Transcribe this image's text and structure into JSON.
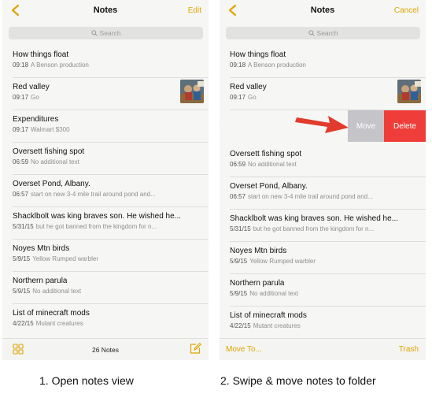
{
  "colors": {
    "accent": "#e0a500",
    "delete": "#ef3e3a",
    "move": "#c5c5c9",
    "arrow": "#e23a2c"
  },
  "left": {
    "title": "Notes",
    "action": "Edit",
    "search_label": "Search",
    "notes": [
      {
        "title": "How things float",
        "time": "09:18",
        "preview": "A Benson production"
      },
      {
        "title": "Red valley",
        "time": "09:17",
        "preview": "Go",
        "thumbnail": true
      },
      {
        "title": "Expenditures",
        "time": "09:17",
        "preview": "Walmart $300"
      },
      {
        "title": "Oversett fishing spot",
        "time": "06:59",
        "preview": "No additional text"
      },
      {
        "title": "Overset Pond, Albany.",
        "time": "06:57",
        "preview": "start on new 3-4 mile trail around pond and..."
      },
      {
        "title": "Shacklbolt was king braves son. He wished he...",
        "time": "5/31/15",
        "preview": "but he got banned from the kingdom for n..."
      },
      {
        "title": "Noyes Mtn birds",
        "time": "5/9/15",
        "preview": "Yellow Rumped warbler"
      },
      {
        "title": "Northern parula",
        "time": "5/9/15",
        "preview": "No additional text"
      },
      {
        "title": "List of minecraft mods",
        "time": "4/22/15",
        "preview": "Mutant creatures"
      }
    ],
    "count_label": "26 Notes",
    "caption": "1. Open notes view"
  },
  "right": {
    "title": "Notes",
    "action": "Cancel",
    "search_label": "Search",
    "notes_top": [
      {
        "title": "How things float",
        "time": "09:18",
        "preview": "A Benson production"
      },
      {
        "title": "Red valley",
        "time": "09:17",
        "preview": "Go",
        "thumbnail": true
      }
    ],
    "swipe": {
      "handle": ")",
      "move_label": "Move",
      "delete_label": "Delete"
    },
    "notes_bottom": [
      {
        "title": "Oversett fishing spot",
        "time": "06:59",
        "preview": "No additional text"
      },
      {
        "title": "Overset Pond, Albany.",
        "time": "06:57",
        "preview": "start on new 3-4 mile trail around pond and..."
      },
      {
        "title": "Shacklbolt was king braves son. He wished he...",
        "time": "5/31/15",
        "preview": "but he got banned from the kingdom for n..."
      },
      {
        "title": "Noyes Mtn birds",
        "time": "5/9/15",
        "preview": "Yellow Rumped warbler"
      },
      {
        "title": "Northern parula",
        "time": "5/9/15",
        "preview": "No additional text"
      },
      {
        "title": "List of minecraft mods",
        "time": "4/22/15",
        "preview": "Mutant creatures"
      }
    ],
    "toolbar_left": "Move To...",
    "toolbar_right": "Trash",
    "caption": "2. Swipe & move notes to folder"
  }
}
